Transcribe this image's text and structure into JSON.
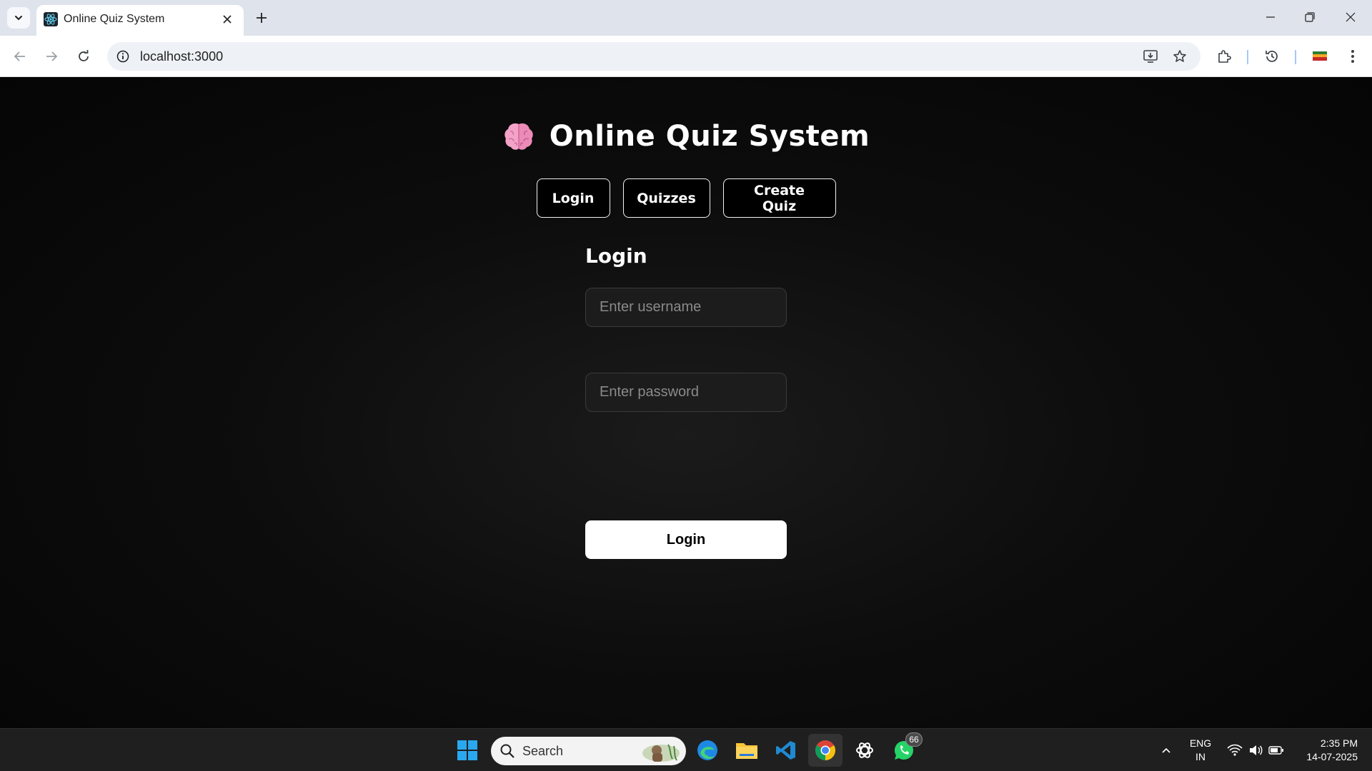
{
  "browser": {
    "tab_title": "Online Quiz System",
    "url": "localhost:3000"
  },
  "app": {
    "title": "Online Quiz System",
    "logo_icon": "brain-icon",
    "nav": [
      {
        "label": "Login"
      },
      {
        "label": "Quizzes"
      },
      {
        "label": "Create Quiz"
      }
    ]
  },
  "login": {
    "heading": "Login",
    "username_placeholder": "Enter username",
    "username_value": "",
    "password_placeholder": "Enter password",
    "password_value": "",
    "submit_label": "Login"
  },
  "taskbar": {
    "search_label": "Search",
    "whatsapp_badge": "66",
    "lang_line1": "ENG",
    "lang_line2": "IN",
    "time": "2:35 PM",
    "date": "14-07-2025"
  },
  "colors": {
    "page_bg": "#0a0a0a",
    "accent": "#ffffff",
    "brain": "#f29fc5"
  }
}
